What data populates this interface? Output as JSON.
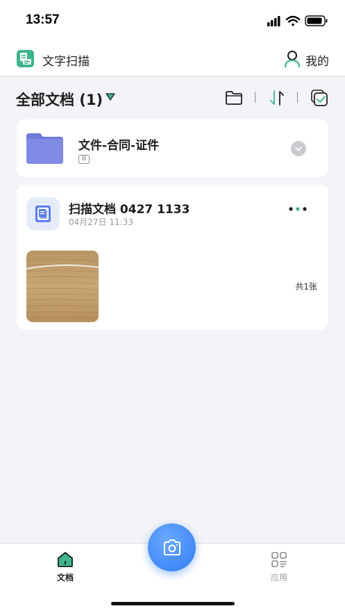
{
  "status_bar": {
    "time": "13:57"
  },
  "header": {
    "app_title": "文字扫描",
    "profile_label": "我的"
  },
  "toolbar": {
    "title": "全部文档 (1)"
  },
  "folder": {
    "name": "文件-合同-证件",
    "count": "0"
  },
  "document": {
    "title": "扫描文档 0427 1133",
    "date": "04月27日 11:33",
    "pages": "共1张"
  },
  "tab_bar": {
    "tabs": [
      {
        "label": "文档",
        "active": true
      },
      {
        "label": "应用",
        "active": false
      }
    ]
  },
  "colors": {
    "accent_green": "#3bb48f",
    "folder_blue": "#7b86e0",
    "camera_blue": "#3b86f7",
    "background": "#f3f4f8"
  }
}
